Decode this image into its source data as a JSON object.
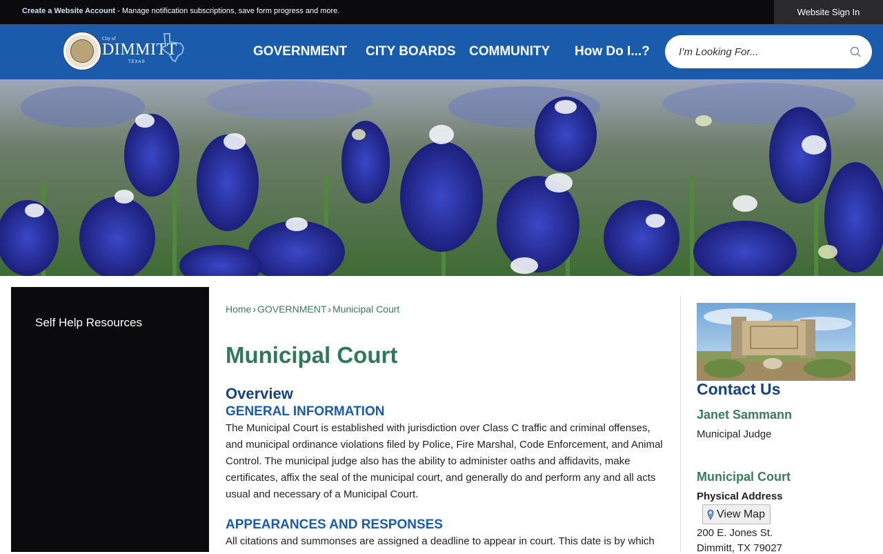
{
  "topbar": {
    "create_account_link": "Create a Website Account",
    "notice_text": " - Manage notification subscriptions, save form progress and more.",
    "signin_label": "Website Sign In"
  },
  "logo": {
    "city_of": "City of",
    "name": "DIMMITT",
    "state": "TEXAS"
  },
  "nav": {
    "items": [
      "GOVERNMENT",
      "CITY BOARDS",
      "COMMUNITY",
      "How Do I...?"
    ]
  },
  "search": {
    "placeholder": "I’m Looking For..."
  },
  "sidebar": {
    "items": [
      "Self Help Resources"
    ]
  },
  "breadcrumb": {
    "home": "Home",
    "parent": "GOVERNMENT",
    "current": "Municipal Court"
  },
  "main": {
    "title": "Municipal Court",
    "overview": "Overview",
    "sections": [
      {
        "heading": "GENERAL INFORMATION",
        "text": "The Municipal Court is established with jurisdiction over Class C traffic and criminal offenses, and municipal ordinance violations filed by Police, Fire Marshal, Code Enforcement, and Animal Control. The municipal judge also has the ability to administer oaths and affidavits, make certificates, affix the seal of the municipal court, and generally do and perform any and all acts usual and necessary of a Municipal Court."
      },
      {
        "heading": "APPEARANCES AND RESPONSES",
        "text": "All citations and summonses are assigned a deadline to appear in court. This date is by which"
      }
    ]
  },
  "contact": {
    "title": "Contact Us",
    "person_name": "Janet Sammann",
    "person_role": "Municipal Judge",
    "office_name": "Municipal Court",
    "address_label": "Physical Address",
    "view_map_label": "View Map",
    "address_line1": "200 E. Jones St.",
    "address_line2": "Dimmitt, TX 79027"
  },
  "colors": {
    "header_blue": "#1a5bab",
    "title_green": "#2e7a58",
    "heading_blue": "#16427f"
  }
}
